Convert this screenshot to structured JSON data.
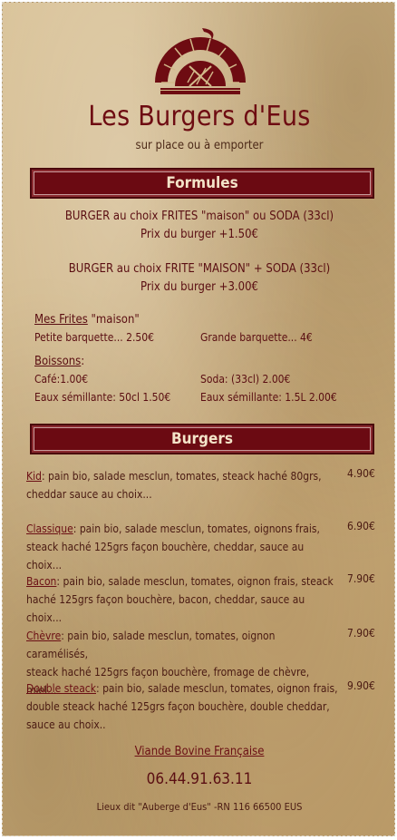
{
  "header": {
    "title": "Les Burgers d'Eus",
    "subtitle": "sur place ou à emporter",
    "logo_icon": "burger-shop-logo"
  },
  "formules": {
    "heading": "Formules",
    "line1": "BURGER au choix FRITES \"maison\" ou SODA (33cl)",
    "line1_price": "Prix du burger +1.50€",
    "line2": "BURGER au choix FRITE \"MAISON\" + SODA (33cl)",
    "line2_price": "Prix du burger +3.00€",
    "frites_label": "Mes Frites",
    "frites_label_rest": "\"maison\"",
    "frites_small": "Petite barquette... 2.50€",
    "frites_large": "Grande barquette... 4€",
    "boissons_label": "Boissons",
    "boissons_colon": ":",
    "cafe": "Café:1.00€",
    "soda": "Soda: (33cl) 2.00€",
    "eau_small": "Eaux sémillante: 50cl 1.50€",
    "eau_large": "Eaux sémillante: 1.5L 2.00€"
  },
  "burgers": {
    "heading": "Burgers",
    "items": [
      {
        "name": "Kid",
        "desc1": ": pain bio, salade mesclun, tomates, steack haché 80grs,",
        "desc2": "cheddar sauce au choix...",
        "desc3": "",
        "price": "4.90€"
      },
      {
        "name": "Classique",
        "desc1": ": pain bio, salade mesclun, tomates, oignons frais,",
        "desc2": "steack haché 125grs façon bouchère, cheddar, sauce au choix...",
        "desc3": "",
        "price": "6.90€"
      },
      {
        "name": "Bacon",
        "desc1": ": pain bio, salade mesclun, tomates, oignon frais, steack",
        "desc2": "haché 125grs façon bouchère, bacon, cheddar, sauce au choix...",
        "desc3": "",
        "price": "7.90€"
      },
      {
        "name": "Chèvre",
        "desc1": ": pain bio, salade mesclun, tomates, oignon caramélisés,",
        "desc2": "steack haché 125grs façon bouchère, fromage de chèvre, miel...",
        "desc3": "",
        "price": "7.90€"
      },
      {
        "name": "Double steack",
        "desc1": ": pain bio, salade mesclun, tomates, oignon frais,",
        "desc2": "double steack haché 125grs façon bouchère, double cheddar,",
        "desc3": "sauce au choix..",
        "price": "9.90€"
      }
    ]
  },
  "footer": {
    "viande": "Viande Bovine Française",
    "phone": "06.44.91.63.11",
    "address": "Lieux dit \"Auberge d'Eus\" -RN 116  66500 EUS"
  }
}
